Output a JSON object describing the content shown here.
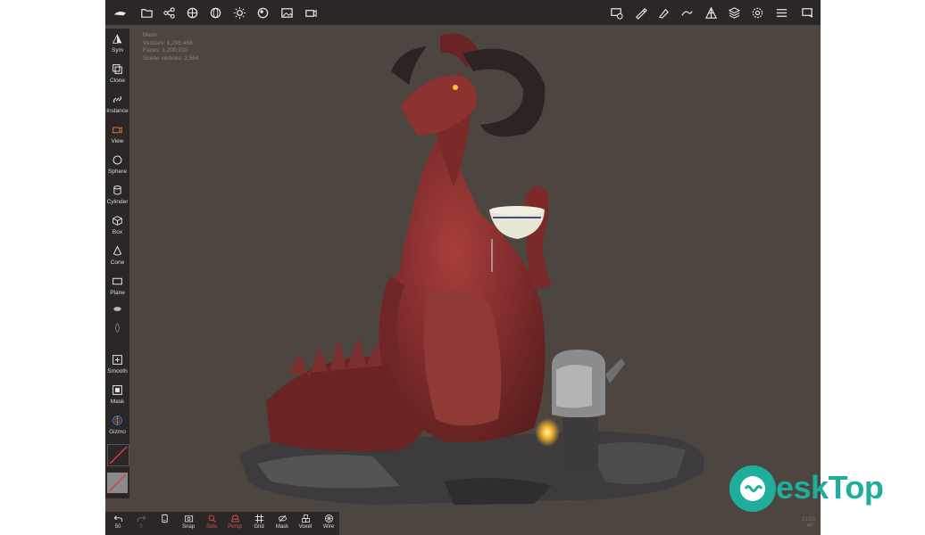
{
  "toolbar": {
    "left_icons": [
      "menu-icon",
      "folder-icon",
      "share-icon",
      "scene-icon",
      "globe-icon",
      "light-icon",
      "material-icon",
      "background-icon",
      "camera-icon"
    ],
    "right_icons": [
      "add-layer-icon",
      "brush-icon",
      "paint-icon",
      "stroke-icon",
      "topology-icon",
      "layers-icon",
      "settings-icon",
      "options-icon",
      "more-icon"
    ]
  },
  "sidebar": {
    "tools": [
      {
        "label": "Sym"
      },
      {
        "label": "Clone"
      },
      {
        "label": "Instance"
      },
      {
        "label": "View"
      },
      {
        "label": "Sphere"
      },
      {
        "label": "Cylinder"
      },
      {
        "label": "Box"
      },
      {
        "label": "Cone"
      },
      {
        "label": "Plane"
      }
    ],
    "lower_tools": [
      {
        "label": "Smooth"
      },
      {
        "label": "Mask"
      },
      {
        "label": "Gizmo"
      }
    ]
  },
  "bottombar": {
    "items": [
      {
        "label": "50"
      },
      {
        "label": "0"
      },
      {
        "label": ""
      },
      {
        "label": "Snap"
      },
      {
        "label": "Solo"
      },
      {
        "label": "Persp"
      },
      {
        "label": "Grid"
      },
      {
        "label": "Mask"
      },
      {
        "label": "Voxel"
      },
      {
        "label": "Wire"
      }
    ]
  },
  "stats": {
    "line1": "Mesh",
    "line2": "Vertices: 1,206,468",
    "line3": "Faces: 1,200,910",
    "line4": "Scene vertices: 2,564"
  },
  "corner_info": {
    "line1": "21/53",
    "line2": "45°"
  },
  "watermark": {
    "text": "eskTop"
  },
  "colors": {
    "viewport": "#4c4540",
    "bars": "#2a2726",
    "accent": "#d0763c",
    "watermark": "#1fae9c"
  }
}
